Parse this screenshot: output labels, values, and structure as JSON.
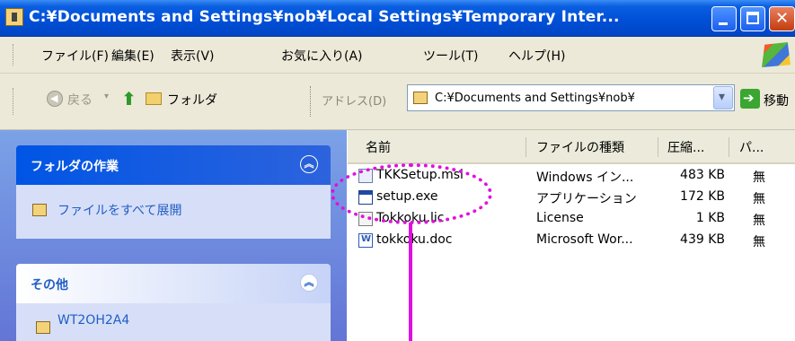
{
  "window": {
    "title": "C:¥Documents and Settings¥nob¥Local Settings¥Temporary Inter..."
  },
  "menu": {
    "items": [
      "ファイル(F)",
      "編集(E)",
      "表示(V)",
      "お気に入り(A)",
      "ツール(T)",
      "ヘルプ(H)"
    ]
  },
  "toolbar": {
    "back_label": "戻る",
    "folders_label": "フォルダ",
    "address_label": "アドレス(D)",
    "address_value": "C:¥Documents and Settings¥nob¥",
    "go_label": "移動"
  },
  "sidebar": {
    "panels": [
      {
        "title": "フォルダの作業",
        "tasks": [
          "ファイルをすべて展開"
        ]
      },
      {
        "title": "その他",
        "tasks": [
          "WT2OH2A4"
        ]
      }
    ]
  },
  "filelist": {
    "columns": [
      "名前",
      "ファイルの種類",
      "圧縮...",
      "パ..."
    ],
    "rows": [
      {
        "name": "TKKSetup.msi",
        "type": "Windows イン...",
        "size": "483 KB",
        "p": "無",
        "icon": "msi-file-icon"
      },
      {
        "name": "setup.exe",
        "type": "アプリケーション",
        "size": "172 KB",
        "p": "無",
        "icon": "exe-file-icon"
      },
      {
        "name": "Tokkoku.lic",
        "type": "License",
        "size": "1 KB",
        "p": "無",
        "icon": "license-file-icon"
      },
      {
        "name": "tokkoku.doc",
        "type": "Microsoft Wor...",
        "size": "439 KB",
        "p": "無",
        "icon": "word-document-icon"
      }
    ]
  },
  "colors": {
    "titlebar": "#0050d8",
    "annotation": "#e010e0",
    "taskpane": "#6375d6"
  }
}
